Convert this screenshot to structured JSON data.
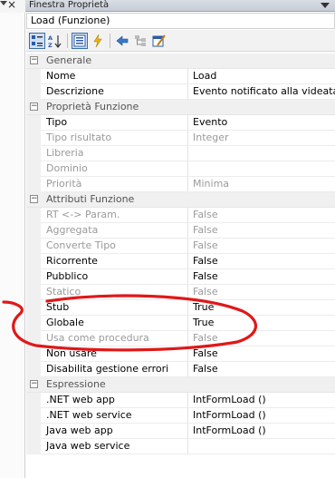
{
  "left_panel": {
    "close_glyph": "×"
  },
  "window": {
    "title": "Finestra Proprietà"
  },
  "selector": {
    "value": "Load (Funzione)"
  },
  "toolbar": {
    "buttons": [
      {
        "icon": "categorized-icon",
        "pressed": true
      },
      {
        "icon": "alphabetical-icon",
        "pressed": false
      },
      {
        "icon": "properties-icon",
        "pressed": true
      },
      {
        "icon": "events-icon",
        "pressed": false
      },
      {
        "icon": "back-icon",
        "pressed": false
      },
      {
        "icon": "hierarchy-icon",
        "pressed": false
      },
      {
        "icon": "property-pages-icon",
        "pressed": false
      }
    ]
  },
  "grid": {
    "rows": [
      {
        "type": "category",
        "label": "Generale"
      },
      {
        "type": "prop",
        "name": "Nome",
        "value": "Load",
        "disabled": false
      },
      {
        "type": "prop",
        "name": "Descrizione",
        "value": "Evento notificato alla videata a",
        "disabled": false
      },
      {
        "type": "category",
        "label": "Proprietà Funzione"
      },
      {
        "type": "prop",
        "name": "Tipo",
        "value": "Evento",
        "disabled": false
      },
      {
        "type": "prop",
        "name": "Tipo risultato",
        "value": "Integer",
        "disabled": true
      },
      {
        "type": "prop",
        "name": "Libreria",
        "value": "",
        "disabled": true
      },
      {
        "type": "prop",
        "name": "Dominio",
        "value": "",
        "disabled": true
      },
      {
        "type": "prop",
        "name": "Priorità",
        "value": "Minima",
        "disabled": true
      },
      {
        "type": "category",
        "label": "Attributi Funzione"
      },
      {
        "type": "prop",
        "name": "RT <-> Param.",
        "value": "False",
        "disabled": true
      },
      {
        "type": "prop",
        "name": "Aggregata",
        "value": "False",
        "disabled": true
      },
      {
        "type": "prop",
        "name": "Converte Tipo",
        "value": "False",
        "disabled": true
      },
      {
        "type": "prop",
        "name": "Ricorrente",
        "value": "False",
        "disabled": false
      },
      {
        "type": "prop",
        "name": "Pubblico",
        "value": "False",
        "disabled": false
      },
      {
        "type": "prop",
        "name": "Statico",
        "value": "False",
        "disabled": true
      },
      {
        "type": "prop",
        "name": "Stub",
        "value": "True",
        "disabled": false
      },
      {
        "type": "prop",
        "name": "Globale",
        "value": "True",
        "disabled": false
      },
      {
        "type": "prop",
        "name": "Usa come procedura",
        "value": "False",
        "disabled": true
      },
      {
        "type": "prop",
        "name": "Non usare",
        "value": "False",
        "disabled": false
      },
      {
        "type": "prop",
        "name": "Disabilita gestione errori",
        "value": "False",
        "disabled": false
      },
      {
        "type": "category",
        "label": "Espressione"
      },
      {
        "type": "prop",
        "name": ".NET web app",
        "value": "IntFormLoad ()",
        "disabled": false
      },
      {
        "type": "prop",
        "name": ".NET web service",
        "value": "IntFormLoad ()",
        "disabled": false
      },
      {
        "type": "prop",
        "name": "Java web app",
        "value": "IntFormLoad ()",
        "disabled": false
      },
      {
        "type": "prop",
        "name": "Java web service",
        "value": "",
        "disabled": false
      }
    ]
  },
  "colors": {
    "annotation": "#e01818",
    "disabled_text": "#9a9a9a",
    "gutter": "#f0f0f0"
  }
}
